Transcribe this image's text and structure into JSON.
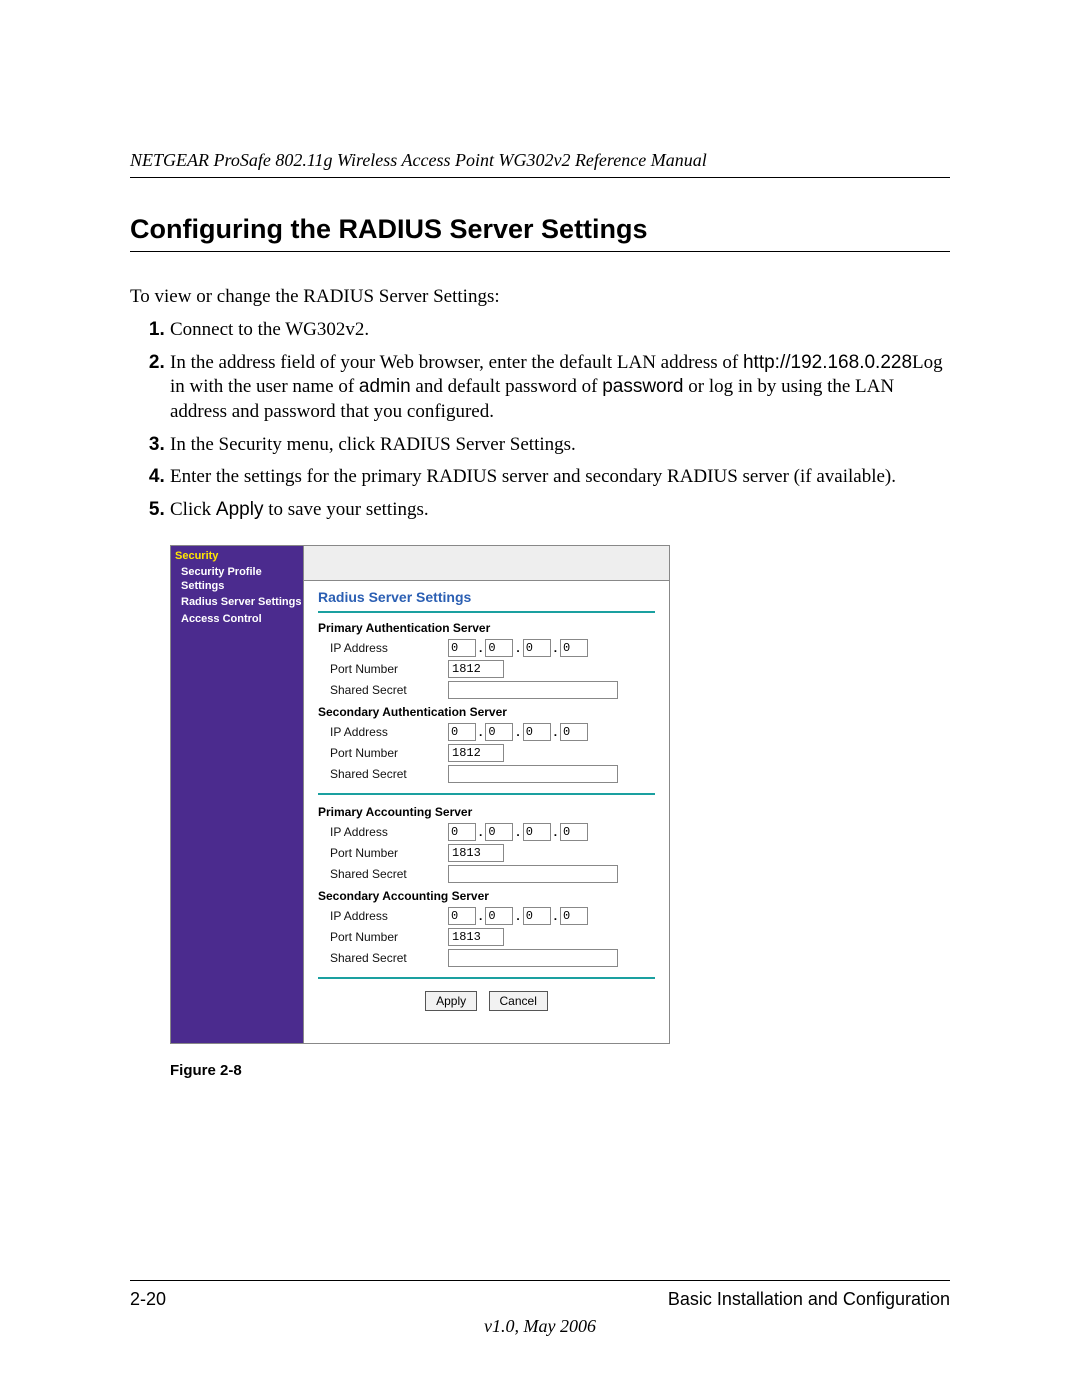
{
  "header": "NETGEAR ProSafe 802.11g Wireless Access Point WG302v2 Reference Manual",
  "section_title": "Configuring the RADIUS Server Settings",
  "intro": "To view or change the RADIUS Server Settings:",
  "steps": {
    "s1": "Connect to the WG302v2.",
    "s2a": "In the address field of your Web browser, enter the default LAN address of ",
    "s2_url": "http://192.168.0.228",
    "s2b": "Log in with the user name of ",
    "s2_user": "admin",
    "s2c": " and default password of ",
    "s2_pass": "password",
    "s2d": " or log in by using the LAN address and password that you configured.",
    "s3": "In the Security menu, click RADIUS Server Settings.",
    "s4": "Enter the settings for the primary RADIUS server and secondary RADIUS server (if available).",
    "s5a": "Click ",
    "s5_btn": "Apply",
    "s5b": " to save your settings."
  },
  "sidebar": {
    "head": "Security",
    "items": [
      "Security Profile Settings",
      "Radius Server Settings",
      "Access Control"
    ]
  },
  "panel": {
    "title": "Radius Server Settings",
    "groups": {
      "pa": "Primary Authentication Server",
      "sa": "Secondary Authentication Server",
      "pc": "Primary Accounting Server",
      "sc": "Secondary Accounting Server"
    },
    "labels": {
      "ip": "IP Address",
      "port": "Port Number",
      "secret": "Shared Secret"
    },
    "values": {
      "ip_oct": "0",
      "port_auth": "1812",
      "port_acct": "1813",
      "secret": ""
    },
    "buttons": {
      "apply": "Apply",
      "cancel": "Cancel"
    }
  },
  "figure_caption": "Figure 2-8",
  "footer": {
    "page": "2-20",
    "section": "Basic Installation and Configuration",
    "version": "v1.0, May 2006"
  }
}
